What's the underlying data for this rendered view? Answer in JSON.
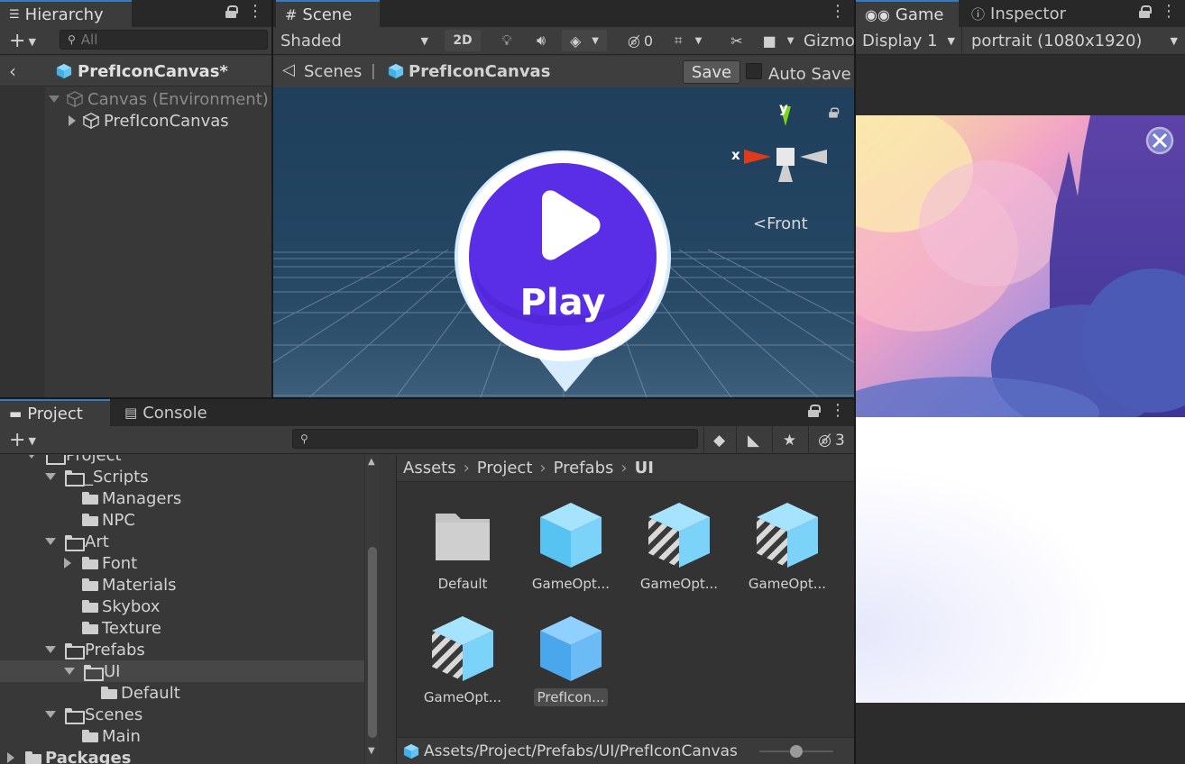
{
  "hierarchy": {
    "tab_label": "Hierarchy",
    "search_placeholder": "All",
    "prefab_title": "PrefIconCanvas*",
    "rows": [
      {
        "label": "Canvas (Environment)"
      },
      {
        "label": "PrefIconCanvas"
      }
    ]
  },
  "scene": {
    "tab_label": "Scene",
    "shading_mode": "Shaded",
    "mode_2d": "2D",
    "hidden_count": "0",
    "gizmos_label": "Gizmo",
    "breadcrumb_root": "Scenes",
    "breadcrumb_sep": "|",
    "breadcrumb_prefab": "PrefIconCanvas",
    "save_label": "Save",
    "autosave_label": "Auto Save",
    "gizmo_axis_y": "y",
    "gizmo_axis_x": "x",
    "view_label": "Front",
    "play_text": "Play",
    "colors": {
      "play_fill": "#5b2de8",
      "play_ring": "#ffffff",
      "scene_bg": "#244663"
    }
  },
  "game": {
    "tab_label": "Game",
    "display": "Display 1",
    "resolution": "portrait (1080x1920)"
  },
  "inspector": {
    "tab_label": "Inspector"
  },
  "project": {
    "tab_label": "Project",
    "console_tab_label": "Console",
    "hidden_count": "3",
    "tree": [
      {
        "label": "Project",
        "depth": 1,
        "arrow": "down",
        "icon": "folder-open"
      },
      {
        "label": "_Scripts",
        "depth": 2,
        "arrow": "down",
        "icon": "folder-open"
      },
      {
        "label": "Managers",
        "depth": 3,
        "arrow": "none",
        "icon": "folder"
      },
      {
        "label": "NPC",
        "depth": 3,
        "arrow": "none",
        "icon": "folder"
      },
      {
        "label": "Art",
        "depth": 2,
        "arrow": "down",
        "icon": "folder-open"
      },
      {
        "label": "Font",
        "depth": 3,
        "arrow": "right",
        "icon": "folder"
      },
      {
        "label": "Materials",
        "depth": 3,
        "arrow": "none",
        "icon": "folder"
      },
      {
        "label": "Skybox",
        "depth": 3,
        "arrow": "none",
        "icon": "folder"
      },
      {
        "label": "Texture",
        "depth": 3,
        "arrow": "none",
        "icon": "folder"
      },
      {
        "label": "Prefabs",
        "depth": 2,
        "arrow": "down",
        "icon": "folder-open"
      },
      {
        "label": "UI",
        "depth": 3,
        "arrow": "down",
        "icon": "folder-open",
        "selected": true
      },
      {
        "label": "Default",
        "depth": 4,
        "arrow": "none",
        "icon": "folder"
      },
      {
        "label": "Scenes",
        "depth": 2,
        "arrow": "down",
        "icon": "folder-open"
      },
      {
        "label": "Main",
        "depth": 3,
        "arrow": "none",
        "icon": "folder"
      },
      {
        "label": "Packages",
        "depth": 0,
        "arrow": "right",
        "icon": "folder",
        "bold": true
      }
    ],
    "breadcrumb": [
      "Assets",
      "Project",
      "Prefabs",
      "UI"
    ],
    "assets": [
      {
        "label": "Default",
        "kind": "folder"
      },
      {
        "label": "GameOpt...",
        "kind": "prefab"
      },
      {
        "label": "GameOpt...",
        "kind": "prefab-variant"
      },
      {
        "label": "GameOpt...",
        "kind": "prefab-variant"
      },
      {
        "label": "GameOpt...",
        "kind": "prefab-variant"
      },
      {
        "label": "PrefIcon...",
        "kind": "prefab",
        "selected": true
      }
    ],
    "status_path": "Assets/Project/Prefabs/UI/PrefIconCanvas",
    "zoom_level": 0.5
  }
}
